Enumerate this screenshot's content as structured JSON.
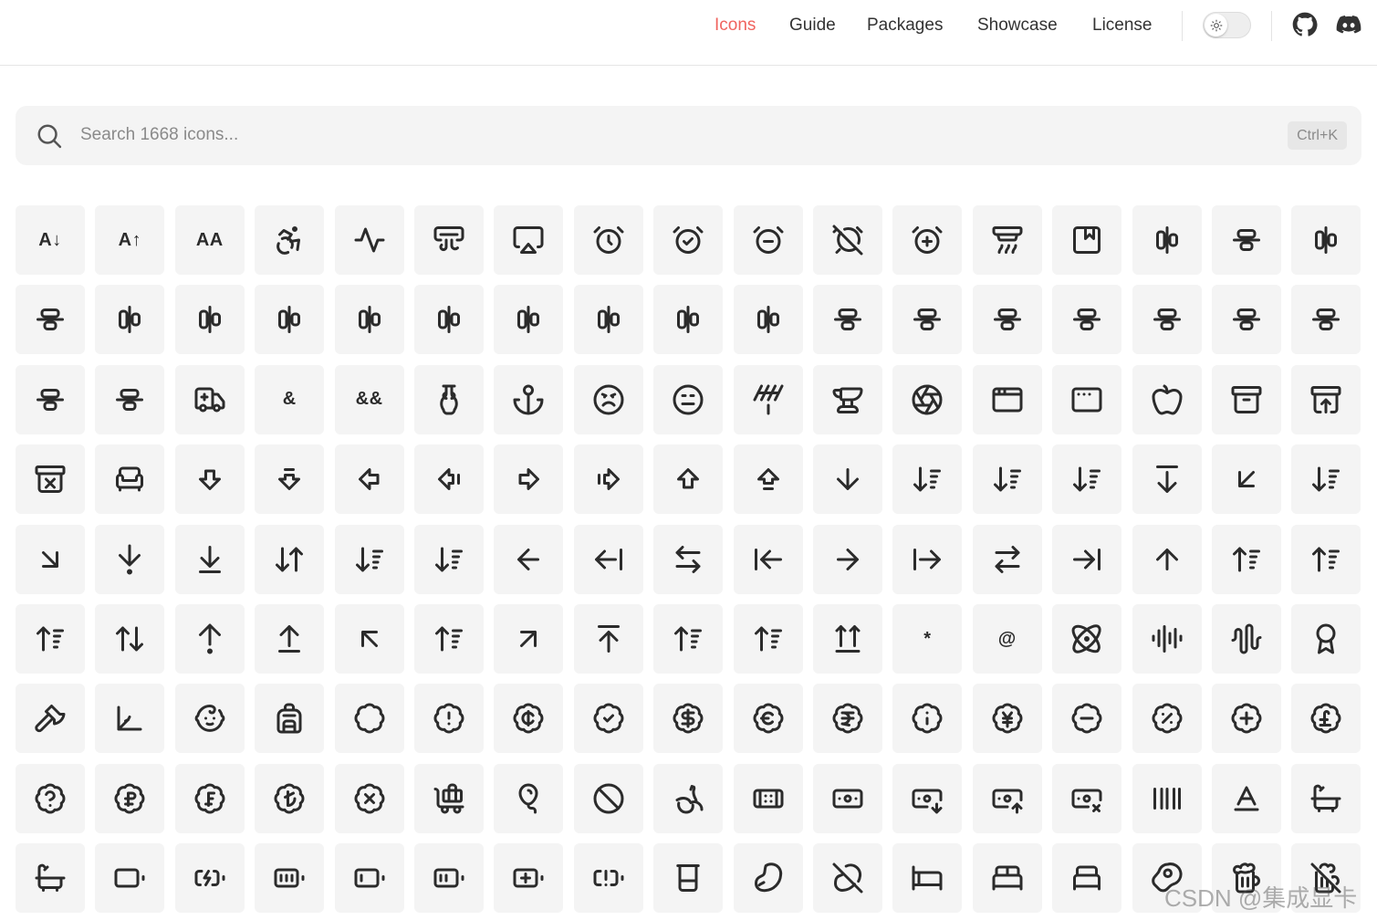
{
  "colors": {
    "accent": "#f0645f",
    "tile_bg": "#f4f4f4",
    "icon_stroke": "#2b2b2b"
  },
  "nav": {
    "items": [
      {
        "label": "Icons",
        "active": true
      },
      {
        "label": "Guide",
        "active": false
      },
      {
        "label": "Packages",
        "active": false
      },
      {
        "label": "Showcase",
        "active": false
      },
      {
        "label": "License",
        "active": false
      }
    ],
    "theme_toggle_icon": "sun-icon",
    "github_icon": "github-icon",
    "discord_icon": "discord-icon"
  },
  "search": {
    "placeholder": "Search 1668 icons...",
    "value": "",
    "shortcut": "Ctrl+K"
  },
  "icons": [
    [
      "a-arrow-down",
      "a-arrow-up",
      "a-large-small",
      "accessibility",
      "activity",
      "air-vent",
      "airplay",
      "alarm-clock",
      "alarm-clock-check",
      "alarm-clock-minus",
      "alarm-clock-off",
      "alarm-clock-plus",
      "alarm-smoke",
      "album",
      "align-center-horizontal",
      "align-center-vertical",
      "align-end-horizontal"
    ],
    [
      "align-end-vertical",
      "align-horizontal-distribute-center",
      "align-horizontal-distribute-end",
      "align-horizontal-distribute-start",
      "align-horizontal-justify-center",
      "align-horizontal-justify-end",
      "align-horizontal-justify-start",
      "align-horizontal-space-around",
      "align-horizontal-space-between",
      "align-start-horizontal",
      "align-start-vertical",
      "align-vertical-distribute-center",
      "align-vertical-distribute-end",
      "align-vertical-distribute-start",
      "align-vertical-justify-center",
      "align-vertical-justify-end",
      "align-vertical-justify-start"
    ],
    [
      "align-vertical-space-around",
      "align-vertical-space-between",
      "ambulance",
      "ampersand",
      "ampersands",
      "amphora",
      "anchor",
      "angry",
      "annoyed",
      "antenna",
      "anvil",
      "aperture",
      "app-window",
      "app-window-mac",
      "apple",
      "archive",
      "archive-restore"
    ],
    [
      "archive-x",
      "armchair",
      "arrow-big-down",
      "arrow-big-down-dash",
      "arrow-big-left",
      "arrow-big-left-dash",
      "arrow-big-right",
      "arrow-big-right-dash",
      "arrow-big-up",
      "arrow-big-up-dash",
      "arrow-down",
      "arrow-down-0-1",
      "arrow-down-1-0",
      "arrow-down-a-z",
      "arrow-down-from-line",
      "arrow-down-left",
      "arrow-down-narrow-wide"
    ],
    [
      "arrow-down-right",
      "arrow-down-to-dot",
      "arrow-down-to-line",
      "arrow-down-up",
      "arrow-down-wide-narrow",
      "arrow-down-z-a",
      "arrow-left",
      "arrow-left-from-line",
      "arrow-left-right",
      "arrow-left-to-line",
      "arrow-right",
      "arrow-right-from-line",
      "arrow-right-left",
      "arrow-right-to-line",
      "arrow-up",
      "arrow-up-0-1",
      "arrow-up-1-0"
    ],
    [
      "arrow-up-a-z",
      "arrow-up-down",
      "arrow-up-from-dot",
      "arrow-up-from-line",
      "arrow-up-left",
      "arrow-up-narrow-wide",
      "arrow-up-right",
      "arrow-up-to-line",
      "arrow-up-wide-narrow",
      "arrow-up-z-a",
      "arrows-up-from-line",
      "asterisk",
      "at-sign",
      "atom",
      "audio-lines",
      "audio-waveform",
      "award"
    ],
    [
      "axe",
      "axis-3d",
      "baby",
      "backpack",
      "badge",
      "badge-alert",
      "badge-cent",
      "badge-check",
      "badge-dollar-sign",
      "badge-euro",
      "badge-indian-rupee",
      "badge-info",
      "badge-japanese-yen",
      "badge-minus",
      "badge-percent",
      "badge-plus",
      "badge-pound-sterling"
    ],
    [
      "badge-help",
      "badge-russian-ruble",
      "badge-swiss-franc",
      "badge-turkish-lira",
      "badge-x",
      "baggage-claim",
      "balloon",
      "ban",
      "banana",
      "bandage",
      "banknote",
      "banknote-arrow-down",
      "banknote-arrow-up",
      "banknote-x",
      "barcode",
      "baseline",
      "bath"
    ],
    [
      "bath",
      "battery",
      "battery-charging",
      "battery-full",
      "battery-low",
      "battery-medium",
      "battery-plus",
      "battery-warning",
      "beaker",
      "bean",
      "bean-off",
      "bed",
      "bed-double",
      "bed-single",
      "beef",
      "beer",
      "beer-off"
    ]
  ],
  "watermark": "CSDN @集成显卡"
}
